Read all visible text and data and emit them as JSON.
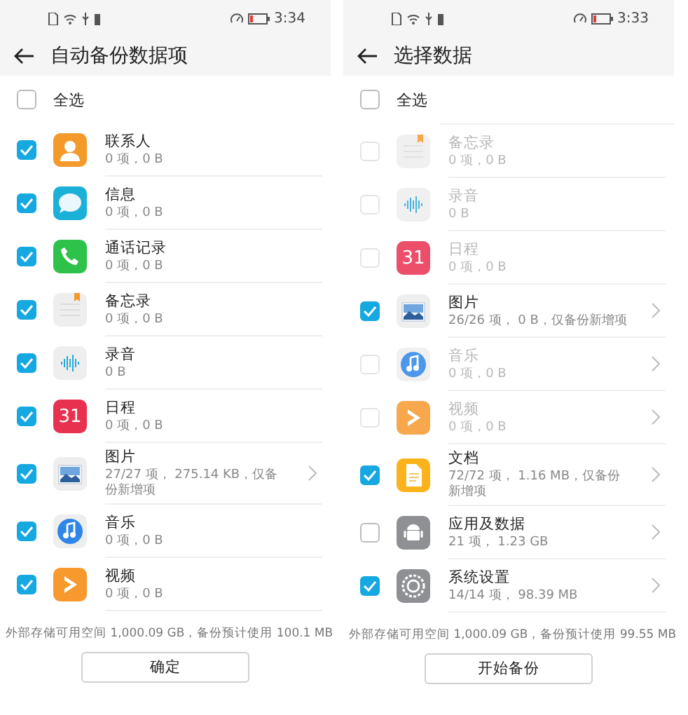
{
  "screens": [
    {
      "status_bar": {
        "time": "3:34"
      },
      "title": "自动备份数据项",
      "select_all": {
        "label": "全选",
        "checked": false
      },
      "items": [
        {
          "kind": "contacts",
          "name": "联系人",
          "detail": "0 项，0 B",
          "checked": true,
          "disabled": false,
          "chevron": false
        },
        {
          "kind": "messages",
          "name": "信息",
          "detail": "0 项，0 B",
          "checked": true,
          "disabled": false,
          "chevron": false
        },
        {
          "kind": "phone",
          "name": "通话记录",
          "detail": "0 项，0 B",
          "checked": true,
          "disabled": false,
          "chevron": false
        },
        {
          "kind": "notes",
          "name": "备忘录",
          "detail": "0 项，0 B",
          "checked": true,
          "disabled": false,
          "chevron": false
        },
        {
          "kind": "recorder",
          "name": "录音",
          "detail": "0 B",
          "checked": true,
          "disabled": false,
          "chevron": false
        },
        {
          "kind": "calendar",
          "icon_text": "31",
          "name": "日程",
          "detail": "0 项，0 B",
          "checked": true,
          "disabled": false,
          "chevron": false
        },
        {
          "kind": "gallery",
          "name": "图片",
          "detail": "27/27 项， 275.14 KB，仅备份新增项",
          "checked": true,
          "disabled": false,
          "chevron": true
        },
        {
          "kind": "music",
          "name": "音乐",
          "detail": "0 项，0 B",
          "checked": true,
          "disabled": false,
          "chevron": false
        },
        {
          "kind": "video",
          "name": "视频",
          "detail": "0 项，0 B",
          "checked": true,
          "disabled": false,
          "chevron": false
        }
      ],
      "footer": "外部存储可用空间 1,000.09 GB，备份预计使用 100.1 MB",
      "button": "确定"
    },
    {
      "status_bar": {
        "time": "3:33"
      },
      "title": "选择数据",
      "select_all": {
        "label": "全选",
        "checked": false
      },
      "items": [
        {
          "kind": "notes",
          "name": "备忘录",
          "detail": "0 项，0 B",
          "checked": false,
          "disabled": true,
          "chevron": false
        },
        {
          "kind": "recorder",
          "name": "录音",
          "detail": "0 B",
          "checked": false,
          "disabled": true,
          "chevron": false
        },
        {
          "kind": "calendar",
          "icon_text": "31",
          "name": "日程",
          "detail": "0 项，0 B",
          "checked": false,
          "disabled": true,
          "chevron": false
        },
        {
          "kind": "gallery",
          "name": "图片",
          "detail": "26/26 项， 0 B，仅备份新增项",
          "checked": true,
          "disabled": false,
          "chevron": true
        },
        {
          "kind": "music",
          "name": "音乐",
          "detail": "0 项，0 B",
          "checked": false,
          "disabled": true,
          "chevron": true
        },
        {
          "kind": "video",
          "name": "视频",
          "detail": "0 项，0 B",
          "checked": false,
          "disabled": true,
          "chevron": true
        },
        {
          "kind": "docs",
          "name": "文档",
          "detail": "72/72 项， 1.16 MB，仅备份新增项",
          "checked": true,
          "disabled": false,
          "chevron": true
        },
        {
          "kind": "android",
          "name": "应用及数据",
          "detail": "21 项， 1.23 GB",
          "checked": false,
          "disabled": false,
          "chevron": true
        },
        {
          "kind": "settings",
          "name": "系统设置",
          "detail": "14/14 项， 98.39 MB",
          "checked": true,
          "disabled": false,
          "chevron": true
        }
      ],
      "footer": "外部存储可用空间 1,000.09 GB，备份预计使用 99.55 MB",
      "button": "开始备份"
    }
  ]
}
